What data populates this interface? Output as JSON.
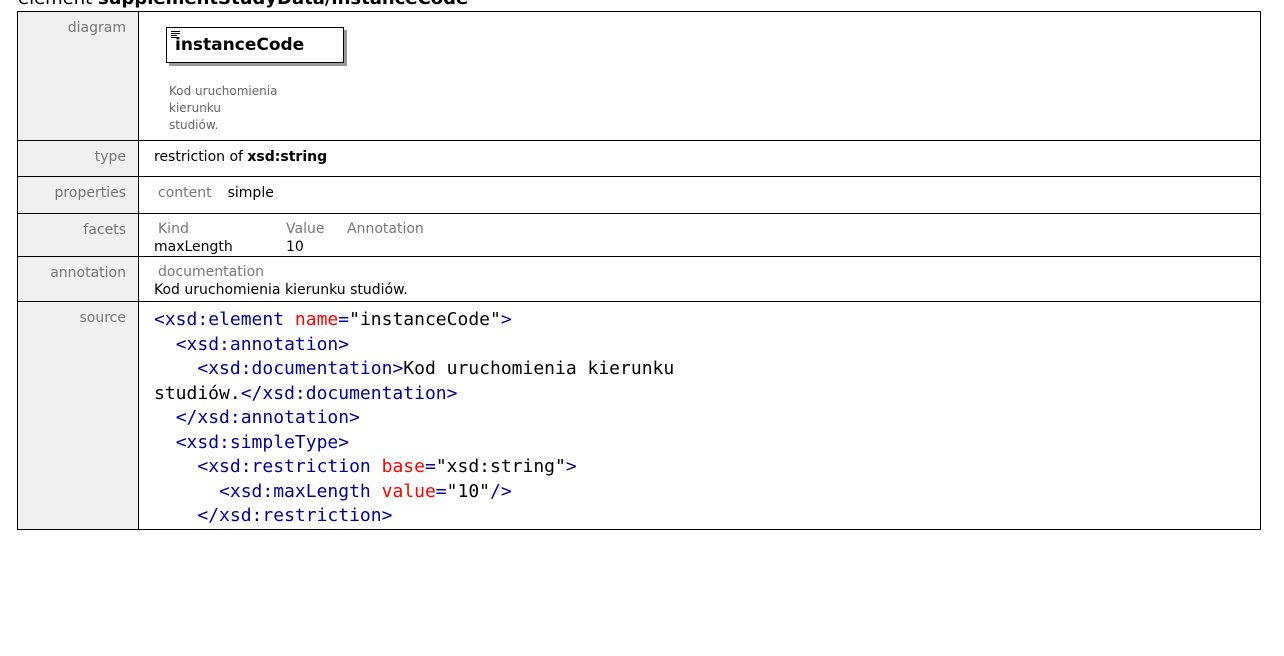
{
  "heading": {
    "prefix": "element ",
    "name": "supplementStudyData/instanceCode"
  },
  "rows": {
    "diagram": {
      "label": "diagram",
      "element_name": "instanceCode",
      "documentation_line1": "Kod uruchomienia kierunku",
      "documentation_line2": "studiów."
    },
    "type": {
      "label": "type",
      "prefix": "restriction of ",
      "base": "xsd:string"
    },
    "properties": {
      "label": "properties",
      "key": "content",
      "value": "simple"
    },
    "facets": {
      "label": "facets",
      "headers": [
        "Kind",
        "Value",
        "Annotation"
      ],
      "rows": [
        {
          "kind": "maxLength",
          "value": "10",
          "annotation": ""
        }
      ]
    },
    "annotation": {
      "label": "annotation",
      "key": "documentation",
      "value": "Kod uruchomienia kierunku studiów."
    },
    "source": {
      "label": "source",
      "lines": [
        {
          "indent": "",
          "open": "<",
          "tag": "xsd:element",
          "attr": "name",
          "attr_val": "\"instanceCode\"",
          "close": ">"
        },
        {
          "indent": "  ",
          "open": "<",
          "tag": "xsd:annotation",
          "close": ">"
        },
        {
          "indent": "    ",
          "open": "<",
          "tag": "xsd:documentation",
          "close": ">",
          "text": "Kod uruchomienia kierunku"
        },
        {
          "indent": "",
          "text": "studiów.",
          "end_open": "</",
          "end_tag": "xsd:documentation",
          "end_close": ">"
        },
        {
          "indent": "  ",
          "open": "</",
          "tag": "xsd:annotation",
          "close": ">"
        },
        {
          "indent": "  ",
          "open": "<",
          "tag": "xsd:simpleType",
          "close": ">"
        },
        {
          "indent": "    ",
          "open": "<",
          "tag": "xsd:restriction",
          "attr": "base",
          "attr_val": "\"xsd:string\"",
          "close": ">"
        },
        {
          "indent": "      ",
          "open": "<",
          "tag": "xsd:maxLength",
          "attr": "value",
          "attr_val": "\"10\"",
          "close": "/>"
        },
        {
          "indent": "    ",
          "open": "</",
          "tag": "xsd:restriction",
          "close": ">"
        }
      ]
    }
  }
}
